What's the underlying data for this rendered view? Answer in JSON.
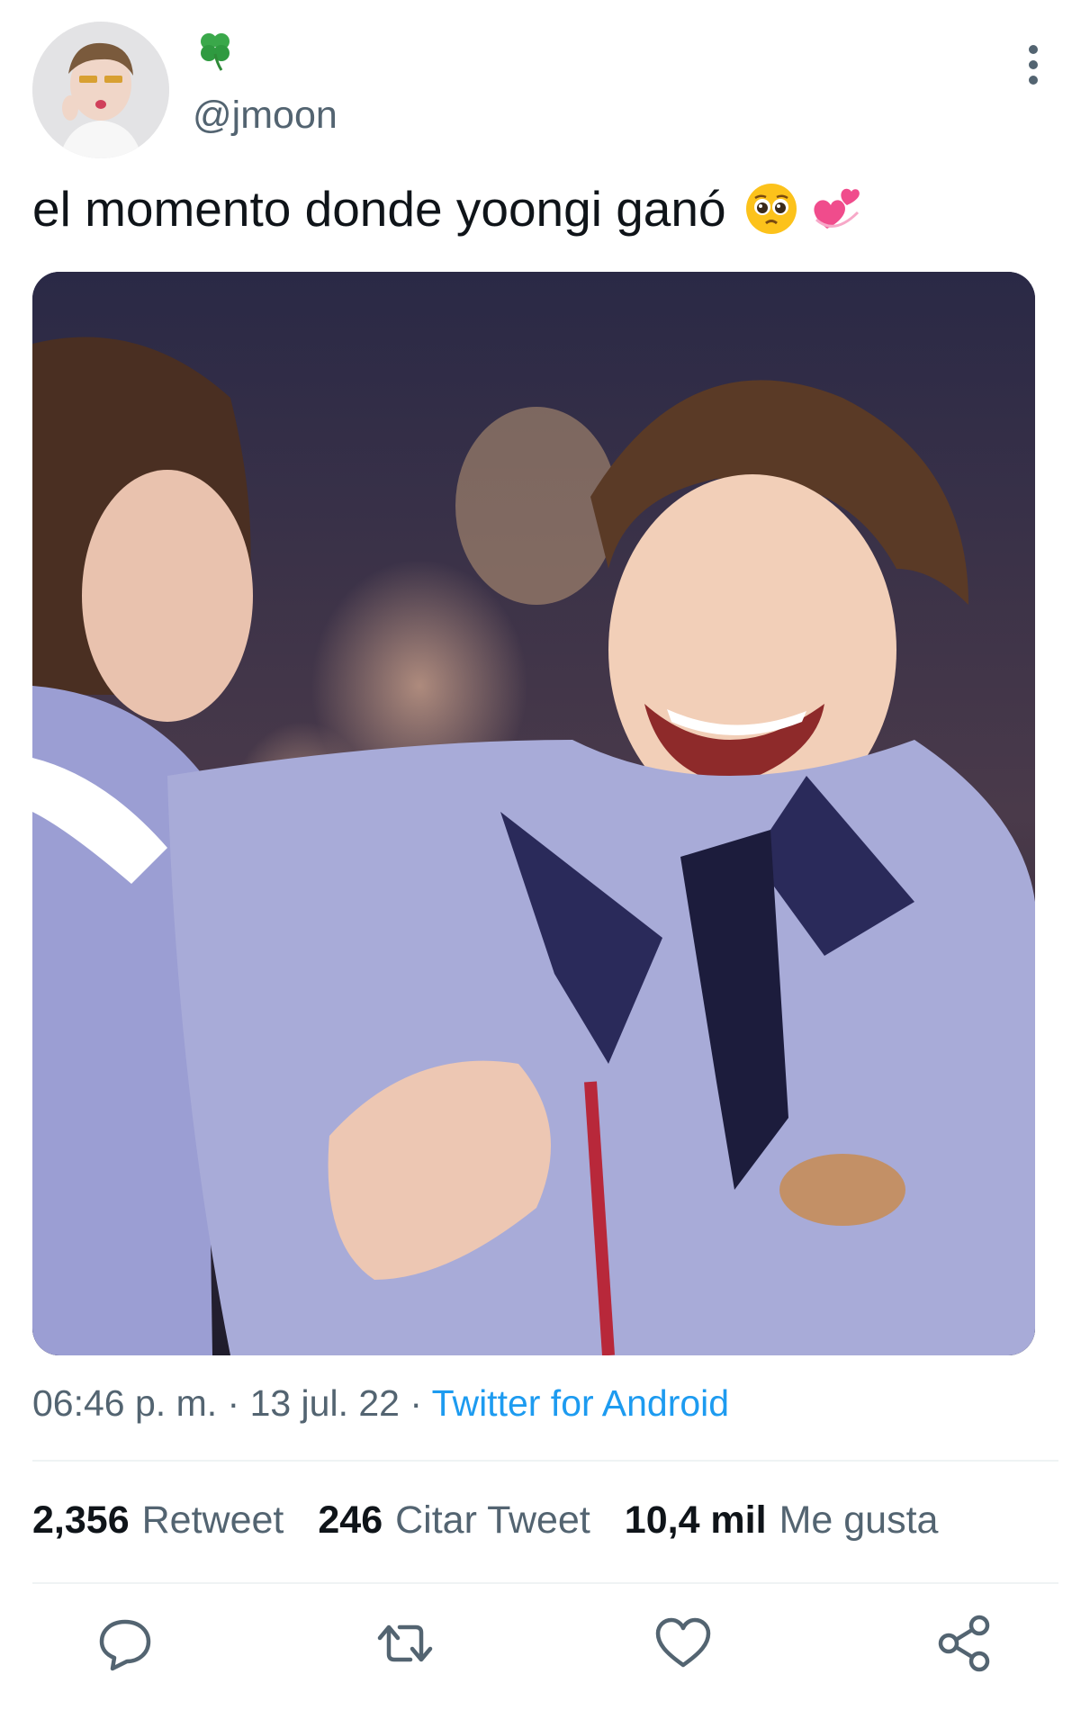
{
  "header": {
    "display_name_icon": "four-leaf-clover-icon",
    "handle": "@jmoon",
    "more_icon": "more-vertical-icon"
  },
  "tweet": {
    "text": "el momento donde yoongi ganó",
    "emojis": [
      "pleading-face-icon",
      "revolving-hearts-icon"
    ],
    "meta": {
      "time": "06:46 p. m.",
      "separator": " · ",
      "date": "13 jul. 22",
      "source": "Twitter for Android"
    }
  },
  "stats": [
    {
      "num": "2,356",
      "label": "Retweet"
    },
    {
      "num": "246",
      "label": "Citar Tweet"
    },
    {
      "num": "10,4 mil",
      "label": "Me gusta"
    }
  ],
  "actions": [
    "reply-icon",
    "retweet-icon",
    "like-icon",
    "share-icon"
  ],
  "colors": {
    "text": "#0f1419",
    "secondary": "#536471",
    "link": "#1d9bf0",
    "divider": "#eff3f4"
  }
}
